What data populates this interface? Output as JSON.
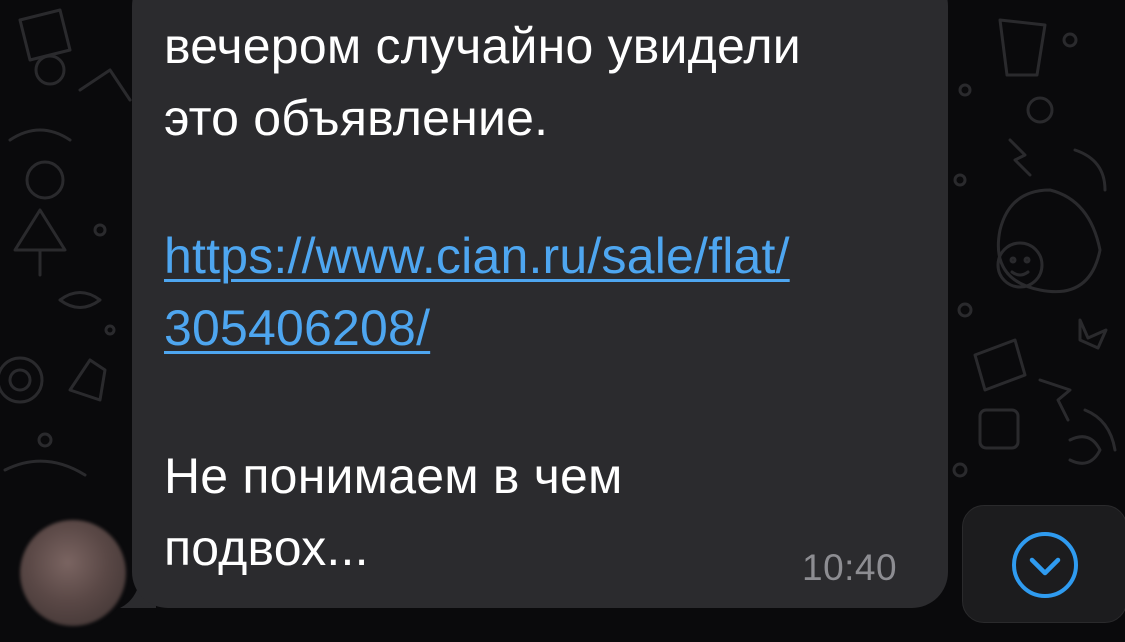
{
  "message": {
    "lines_before": [
      "вечером случайно увидели",
      "это объявление."
    ],
    "link_lines": [
      "https://www.cian.ru/sale/flat/",
      "305406208/"
    ],
    "lines_after": [
      "Не понимаем в чем",
      "подвох..."
    ],
    "time": "10:40"
  },
  "sender": {
    "avatar": "blurred-avatar"
  },
  "controls": {
    "scroll_down_icon": "chevron-down-circle-icon"
  },
  "colors": {
    "background": "#0a0a0c",
    "bubble": "#2b2b2e",
    "text": "#ffffff",
    "link": "#4ea6f0",
    "timestamp": "#8d8d92",
    "accent": "#2f9bf0"
  }
}
